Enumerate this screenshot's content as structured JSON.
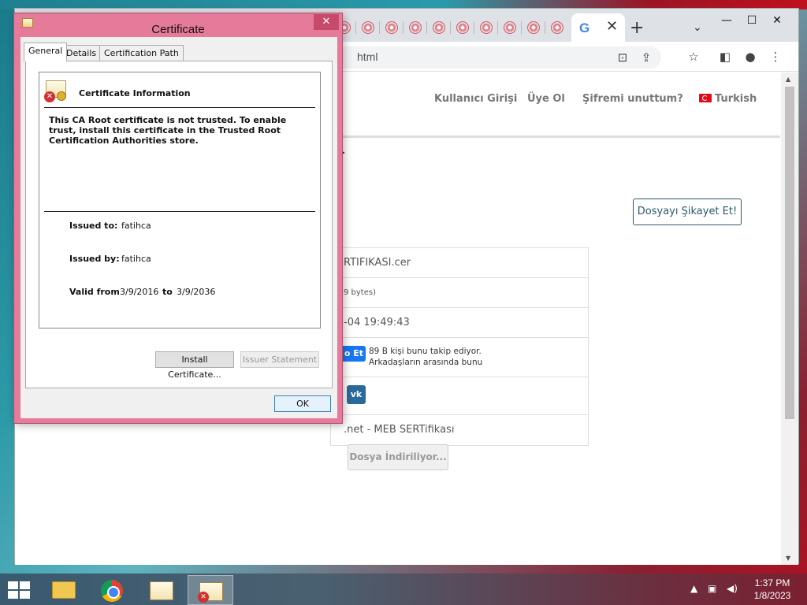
{
  "browser": {
    "url_fragment": "html",
    "window_controls": {
      "minimize": "—",
      "maximize": "☐",
      "close": "✕"
    },
    "new_tab": "+",
    "tab_list": "⌄",
    "tab_close": "✕",
    "google_tab_icon": "G"
  },
  "page": {
    "nav": {
      "login": "Kullanıcı Girişi",
      "register": "Üye Ol",
      "forgot": "Şifremi unuttum?",
      "language": "Turkish"
    },
    "heading_fragment": "r",
    "report_button": "Dosyayı Şikayet Et!",
    "file_rows": {
      "name": "RTIFIKASI.cer",
      "size": "9 bytes)",
      "date": "-04 19:49:43",
      "facebook_button": "o Et",
      "facebook_text_1": "89 B kişi bunu takip ediyor.",
      "facebook_text_2": "Arkadaşların arasında bunu",
      "vk_label": "vk",
      "source": ".net - MEB SERTifikası"
    },
    "download_button": "Dosya İndiriliyor..."
  },
  "certificate": {
    "title": "Certificate",
    "close": "✕",
    "tabs": [
      "General",
      "Details",
      "Certification Path"
    ],
    "info_heading": "Certificate Information",
    "message": "This CA Root certificate is not trusted. To enable trust, install this certificate in the Trusted Root Certification Authorities store.",
    "issued_to_label": "Issued to:",
    "issued_to": "fatihca",
    "issued_by_label": "Issued by:",
    "issued_by": "fatihca",
    "valid_from_label": "Valid from",
    "valid_from": "3/9/2016",
    "to_label": "to",
    "valid_to": "3/9/2036",
    "install_button": "Install Certificate...",
    "issuer_statement_button": "Issuer Statement",
    "ok_button": "OK"
  },
  "taskbar": {
    "time": "1:37 PM",
    "date": "1/8/2023"
  }
}
